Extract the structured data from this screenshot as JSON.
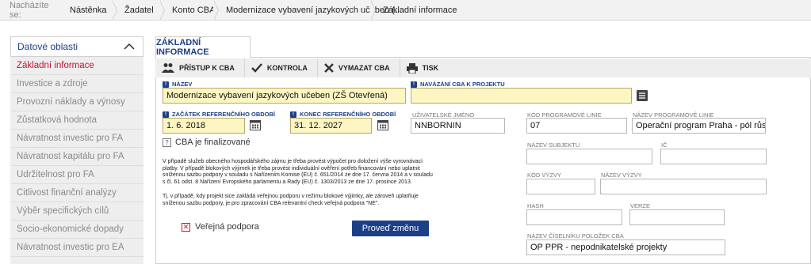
{
  "breadcrumb": {
    "prefix": "Nacházíte se:",
    "items": [
      "Nástěnka",
      "Žadatel",
      "Konto CBA",
      "Modernizace vybavení jazykových učeben (...",
      "Základní informace"
    ]
  },
  "sidebar": {
    "title": "Datové oblasti",
    "items": [
      {
        "label": "Základní informace",
        "active": true
      },
      {
        "label": "Investice a zdroje"
      },
      {
        "label": "Provozní náklady a výnosy"
      },
      {
        "label": "Zůstatková hodnota"
      },
      {
        "label": "Návratnost investic pro FA"
      },
      {
        "label": "Návratnost kapitálu pro FA"
      },
      {
        "label": "Udržitelnost pro FA"
      },
      {
        "label": "Citlivost finanční analýzy"
      },
      {
        "label": "Výběr specifických cílů"
      },
      {
        "label": "Socio-ekonomické dopady"
      },
      {
        "label": "Návratnost investic pro EA"
      }
    ]
  },
  "tab": {
    "label": "ZÁKLADNÍ INFORMACE"
  },
  "toolbar": {
    "access": "PŘÍSTUP K CBA",
    "check": "KONTROLA",
    "delete": "VYMAZAT CBA",
    "print": "TISK"
  },
  "form": {
    "nazev_label": "NÁZEV",
    "nazev_value": "Modernizace vybavení jazykových učeben (ZŠ Otevřená)",
    "navazani_label": "NAVÁZÁNÍ CBA K PROJEKTU",
    "navazani_value": "",
    "zacatek_label": "ZAČÁTEK REFERENČNÍHO OBDOBÍ",
    "zacatek_value": "1. 6. 2018",
    "konec_label": "KONEC REFERENČNÍHO OBDOBÍ",
    "konec_value": "31. 12. 2027",
    "uzivatel_label": "UŽIVATELSKÉ JMÉNO",
    "uzivatel_value": "NNBORNIN",
    "kod_linie_label": "KÓD PROGRAMOVÉ LINIE",
    "kod_linie_value": "07",
    "nazev_linie_label": "NÁZEV PROGRAMOVÉ LINIE",
    "nazev_linie_value": "Operační program Praha - pól růstu",
    "finalized_label": "CBA je finalizované",
    "subjekt_label": "NÁZEV SUBJEKTU",
    "subjekt_value": "",
    "ic_label": "IČ",
    "ic_value": "",
    "kod_vyzvy_label": "KÓD VÝZVY",
    "kod_vyzvy_value": "",
    "nazev_vyzvy_label": "NÁZEV VÝZVY",
    "nazev_vyzvy_value": "",
    "hash_label": "HASH",
    "hash_value": "",
    "verze_label": "VERZE",
    "verze_value": "",
    "ciselnik_label": "NÁZEV ČÍSELNÍKU POLOŽEK CBA",
    "ciselnik_value": "OP PPR - nepodnikatelské projekty",
    "note1_l1": "V případě služeb obecného hospodářského zájmu je třeba provést výpočet pro doložení výše vyrovnávací",
    "note1_l2": "platby. V případě blokových výjimek je třeba provést individuální ověření potřeb financování nebo uplatnit",
    "note1_l3": "sníženou sazbu podpory v souladu s Nařízením Komise (EU) č. 651/2014 ze dne 17. června 2014 a v souladu",
    "note1_l4": "s čl. 61 odst. 8 Nařízení Evropského parlamentu a Rady (EU) č. 1303/2013 ze dne 17. prosince 2013.",
    "note2_l1": "Tj. v případě, kdy projekt sice zakládá veřejnou podporu v režimu blokové výjimky, ale zároveň uplatňuje",
    "note2_l2": "sníženou sazbu podpory, je pro zpracování CBA relevantní check veřejná podpora \"NE\".",
    "verejna_label": "Veřejná podpora",
    "submit_label": "Proveď změnu"
  }
}
